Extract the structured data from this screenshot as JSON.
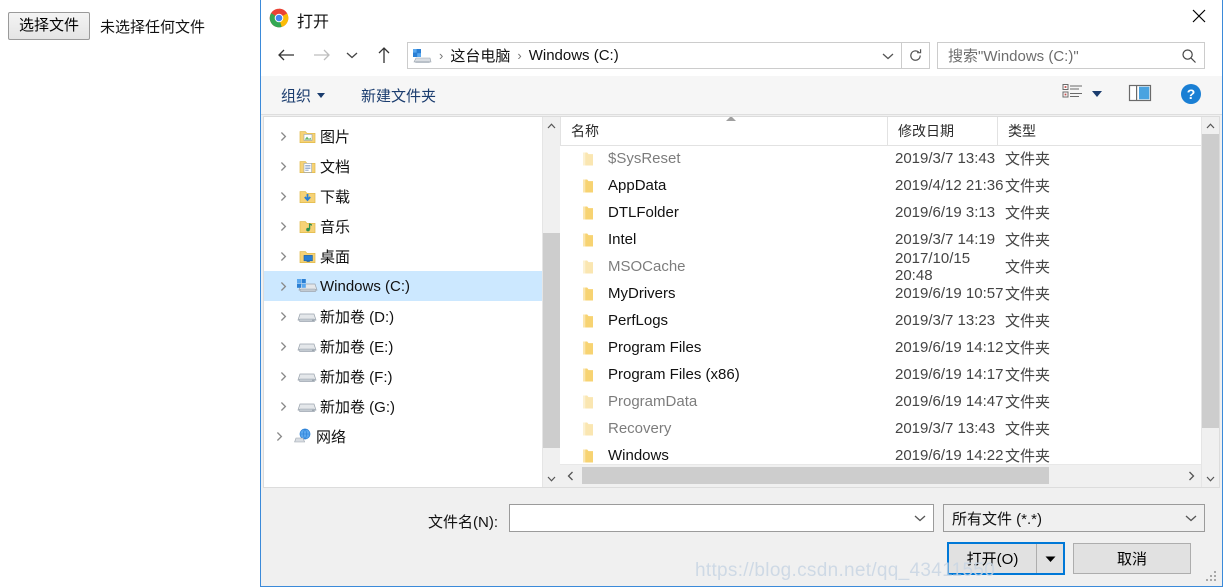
{
  "background": {
    "choose_file_button": "选择文件",
    "no_file_text": "未选择任何文件"
  },
  "dialog": {
    "title": "打开",
    "close_label": "×"
  },
  "nav": {
    "back": "←",
    "forward": "→",
    "recent": "⌄",
    "up": "↑",
    "breadcrumbs": [
      "这台电脑",
      "Windows (C:)"
    ],
    "separator": "›",
    "refresh": "↻",
    "address_chevron": "⌄"
  },
  "search": {
    "placeholder": "搜索\"Windows (C:)\"",
    "icon": "search-icon"
  },
  "command_bar": {
    "organize": "组织",
    "new_folder": "新建文件夹",
    "view_options_icon": "view-options-icon",
    "preview_pane_icon": "preview-pane-icon",
    "help_icon": "help-icon"
  },
  "sidebar": {
    "items": [
      {
        "label": "图片",
        "icon": "pictures-folder-icon",
        "level": 1,
        "selected": false
      },
      {
        "label": "文档",
        "icon": "documents-folder-icon",
        "level": 1,
        "selected": false
      },
      {
        "label": "下载",
        "icon": "downloads-folder-icon",
        "level": 1,
        "selected": false
      },
      {
        "label": "音乐",
        "icon": "music-folder-icon",
        "level": 1,
        "selected": false
      },
      {
        "label": "桌面",
        "icon": "desktop-folder-icon",
        "level": 1,
        "selected": false
      },
      {
        "label": "Windows (C:)",
        "icon": "windows-drive-icon",
        "level": 1,
        "selected": true
      },
      {
        "label": "新加卷 (D:)",
        "icon": "drive-icon",
        "level": 1,
        "selected": false
      },
      {
        "label": "新加卷 (E:)",
        "icon": "drive-icon",
        "level": 1,
        "selected": false
      },
      {
        "label": "新加卷 (F:)",
        "icon": "drive-icon",
        "level": 1,
        "selected": false
      },
      {
        "label": "新加卷 (G:)",
        "icon": "drive-icon",
        "level": 1,
        "selected": false
      },
      {
        "label": "网络",
        "icon": "network-icon",
        "level": 0,
        "selected": false
      }
    ]
  },
  "file_list": {
    "columns": [
      "名称",
      "修改日期",
      "类型"
    ],
    "sort_column": "名称",
    "sort_direction": "asc",
    "rows": [
      {
        "name": "$SysReset",
        "date": "2019/3/7 13:43",
        "type": "文件夹",
        "dim": true
      },
      {
        "name": "AppData",
        "date": "2019/4/12 21:36",
        "type": "文件夹",
        "dim": false
      },
      {
        "name": "DTLFolder",
        "date": "2019/6/19 3:13",
        "type": "文件夹",
        "dim": false
      },
      {
        "name": "Intel",
        "date": "2019/3/7 14:19",
        "type": "文件夹",
        "dim": false
      },
      {
        "name": "MSOCache",
        "date": "2017/10/15 20:48",
        "type": "文件夹",
        "dim": true
      },
      {
        "name": "MyDrivers",
        "date": "2019/6/19 10:57",
        "type": "文件夹",
        "dim": false
      },
      {
        "name": "PerfLogs",
        "date": "2019/3/7 13:23",
        "type": "文件夹",
        "dim": false
      },
      {
        "name": "Program Files",
        "date": "2019/6/19 14:12",
        "type": "文件夹",
        "dim": false
      },
      {
        "name": "Program Files (x86)",
        "date": "2019/6/19 14:17",
        "type": "文件夹",
        "dim": false
      },
      {
        "name": "ProgramData",
        "date": "2019/6/19 14:47",
        "type": "文件夹",
        "dim": true
      },
      {
        "name": "Recovery",
        "date": "2019/3/7 13:43",
        "type": "文件夹",
        "dim": true
      },
      {
        "name": "Windows",
        "date": "2019/6/19 14:22",
        "type": "文件夹",
        "dim": false
      }
    ]
  },
  "footer": {
    "filename_label": "文件名(N):",
    "filename_value": "",
    "filename_placeholder": "",
    "filter_value": "所有文件 (*.*)",
    "open_button": "打开(O)",
    "open_split_caret": "▼",
    "cancel_button": "取消"
  },
  "watermark": "https://blog.csdn.net/qq_43411550",
  "colors": {
    "accent": "#0078d7",
    "selection": "#cce8ff",
    "command_link": "#1a3c6e",
    "folder": "#f7d372"
  }
}
